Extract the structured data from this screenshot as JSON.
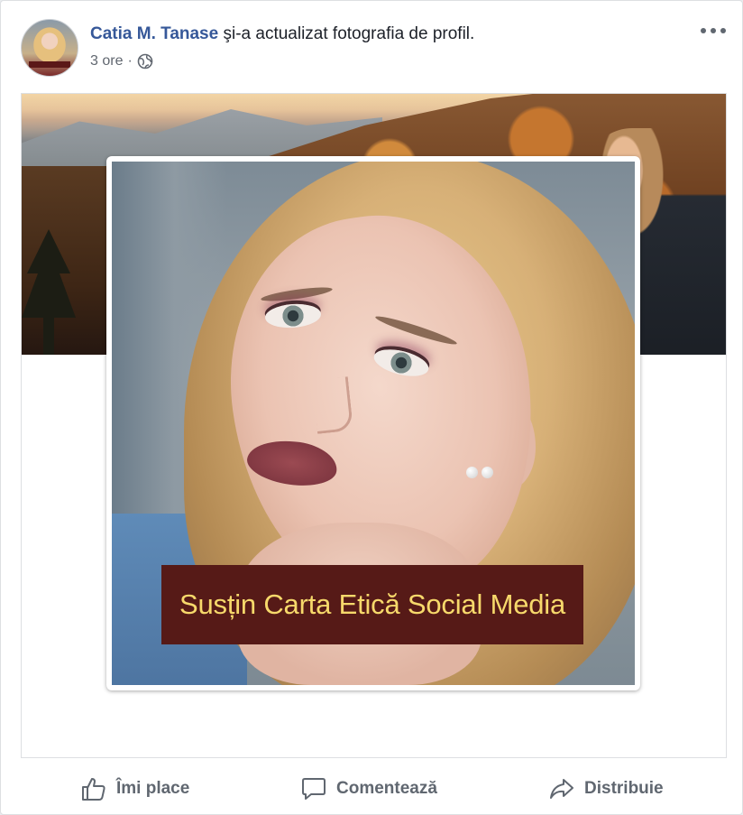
{
  "post": {
    "author": "Catia M. Tanase",
    "action_text": "şi-a actualizat fotografia de profil.",
    "timestamp": "3 ore",
    "separator": "·",
    "privacy_icon": "globe-icon",
    "more_icon": "more-options-icon"
  },
  "media": {
    "banner_text": "Susțin Carta Etică Social Media",
    "banner_color": "#561a17",
    "banner_text_color": "#f7d96b"
  },
  "actions": {
    "like": "Îmi place",
    "comment": "Comentează",
    "share": "Distribuie"
  },
  "colors": {
    "link": "#365899",
    "meta": "#616770",
    "action": "#606770"
  }
}
